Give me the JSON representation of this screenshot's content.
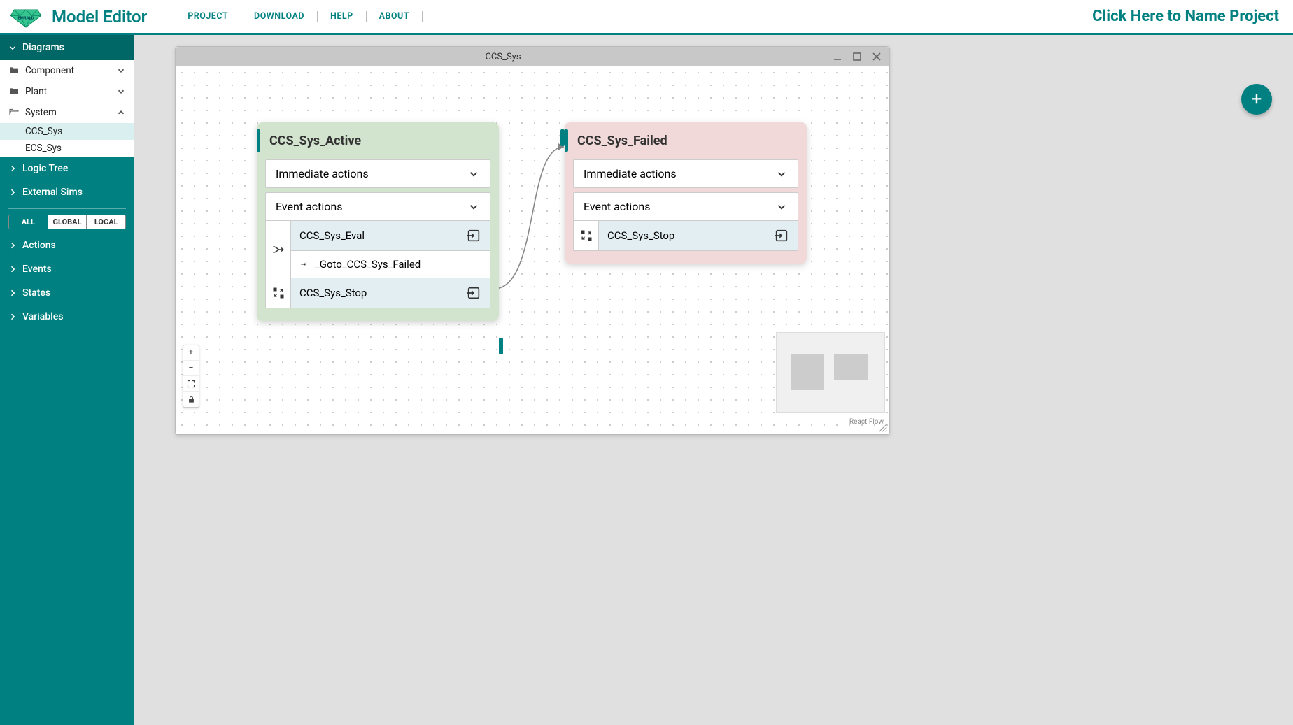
{
  "header": {
    "app_title": "Model Editor",
    "menu": [
      "PROJECT",
      "DOWNLOAD",
      "HELP",
      "ABOUT"
    ],
    "project_name": "Click Here to Name Project"
  },
  "sidebar": {
    "diagrams_label": "Diagrams",
    "folders": [
      {
        "label": "Component",
        "expanded": false
      },
      {
        "label": "Plant",
        "expanded": false
      },
      {
        "label": "System",
        "expanded": true,
        "children": [
          "CCS_Sys",
          "ECS_Sys"
        ]
      }
    ],
    "sections": [
      "Logic Tree",
      "External Sims"
    ],
    "filters": [
      "ALL",
      "GLOBAL",
      "LOCAL"
    ],
    "filter_active": "ALL",
    "lists": [
      "Actions",
      "Events",
      "States",
      "Variables"
    ]
  },
  "window": {
    "title": "CCS_Sys"
  },
  "nodes": {
    "active": {
      "title": "CCS_Sys_Active",
      "immediate_label": "Immediate actions",
      "event_label": "Event actions",
      "events": [
        {
          "name": "CCS_Sys_Eval",
          "goto": "_Goto_CCS_Sys_Failed",
          "icon": "merge"
        },
        {
          "name": "CCS_Sys_Stop",
          "icon": "swap"
        }
      ]
    },
    "failed": {
      "title": "CCS_Sys_Failed",
      "immediate_label": "Immediate actions",
      "event_label": "Event actions",
      "events": [
        {
          "name": "CCS_Sys_Stop",
          "icon": "swap"
        }
      ]
    }
  },
  "reactflow_attr": "React Flow"
}
